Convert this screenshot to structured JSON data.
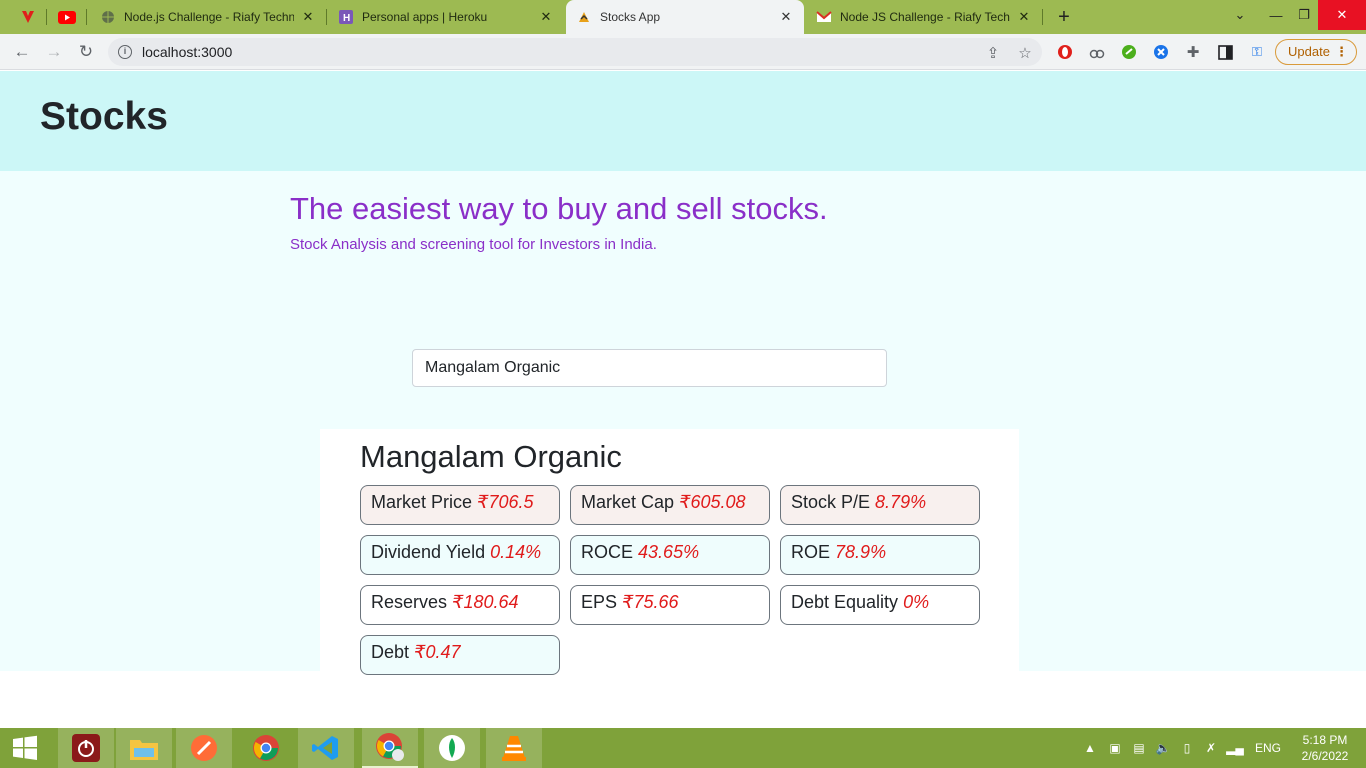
{
  "browser": {
    "tabs": [
      {
        "title": "Node.js Challenge - Riafy Techno",
        "icon": "globe-icon"
      },
      {
        "title": "Personal apps | Heroku",
        "icon": "heroku-icon"
      },
      {
        "title": "Stocks App",
        "icon": "stocks-app-icon",
        "active": true
      },
      {
        "title": "Node JS Challenge - Riafy Techno",
        "icon": "gmail-icon"
      }
    ],
    "url": "localhost:3000",
    "update_label": "Update"
  },
  "app": {
    "brand": "Stocks",
    "headline": "The easiest way to buy and sell stocks.",
    "subheadline": "Stock Analysis and screening tool for Investors in India.",
    "search": {
      "value": "Mangalam Organic",
      "placeholder": ""
    },
    "stock": {
      "name": "Mangalam Organic",
      "metrics": [
        {
          "label": "Market Price",
          "value": "₹706.5"
        },
        {
          "label": "Market Cap",
          "value": "₹605.08"
        },
        {
          "label": "Stock P/E",
          "value": "8.79%"
        },
        {
          "label": "Dividend Yield",
          "value": "0.14%"
        },
        {
          "label": "ROCE",
          "value": "43.65%"
        },
        {
          "label": "ROE",
          "value": "78.9%"
        },
        {
          "label": "Reserves",
          "value": "₹180.64"
        },
        {
          "label": "EPS",
          "value": "₹75.66"
        },
        {
          "label": "Debt Equality",
          "value": "0%"
        },
        {
          "label": "Debt",
          "value": "₹0.47"
        }
      ]
    },
    "colors": {
      "header_bg": "#ccf7f7",
      "accent": "#8a2fc8",
      "value": "#e01b1b"
    }
  },
  "taskbar": {
    "language": "ENG",
    "time": "5:18 PM",
    "date": "2/6/2022"
  }
}
